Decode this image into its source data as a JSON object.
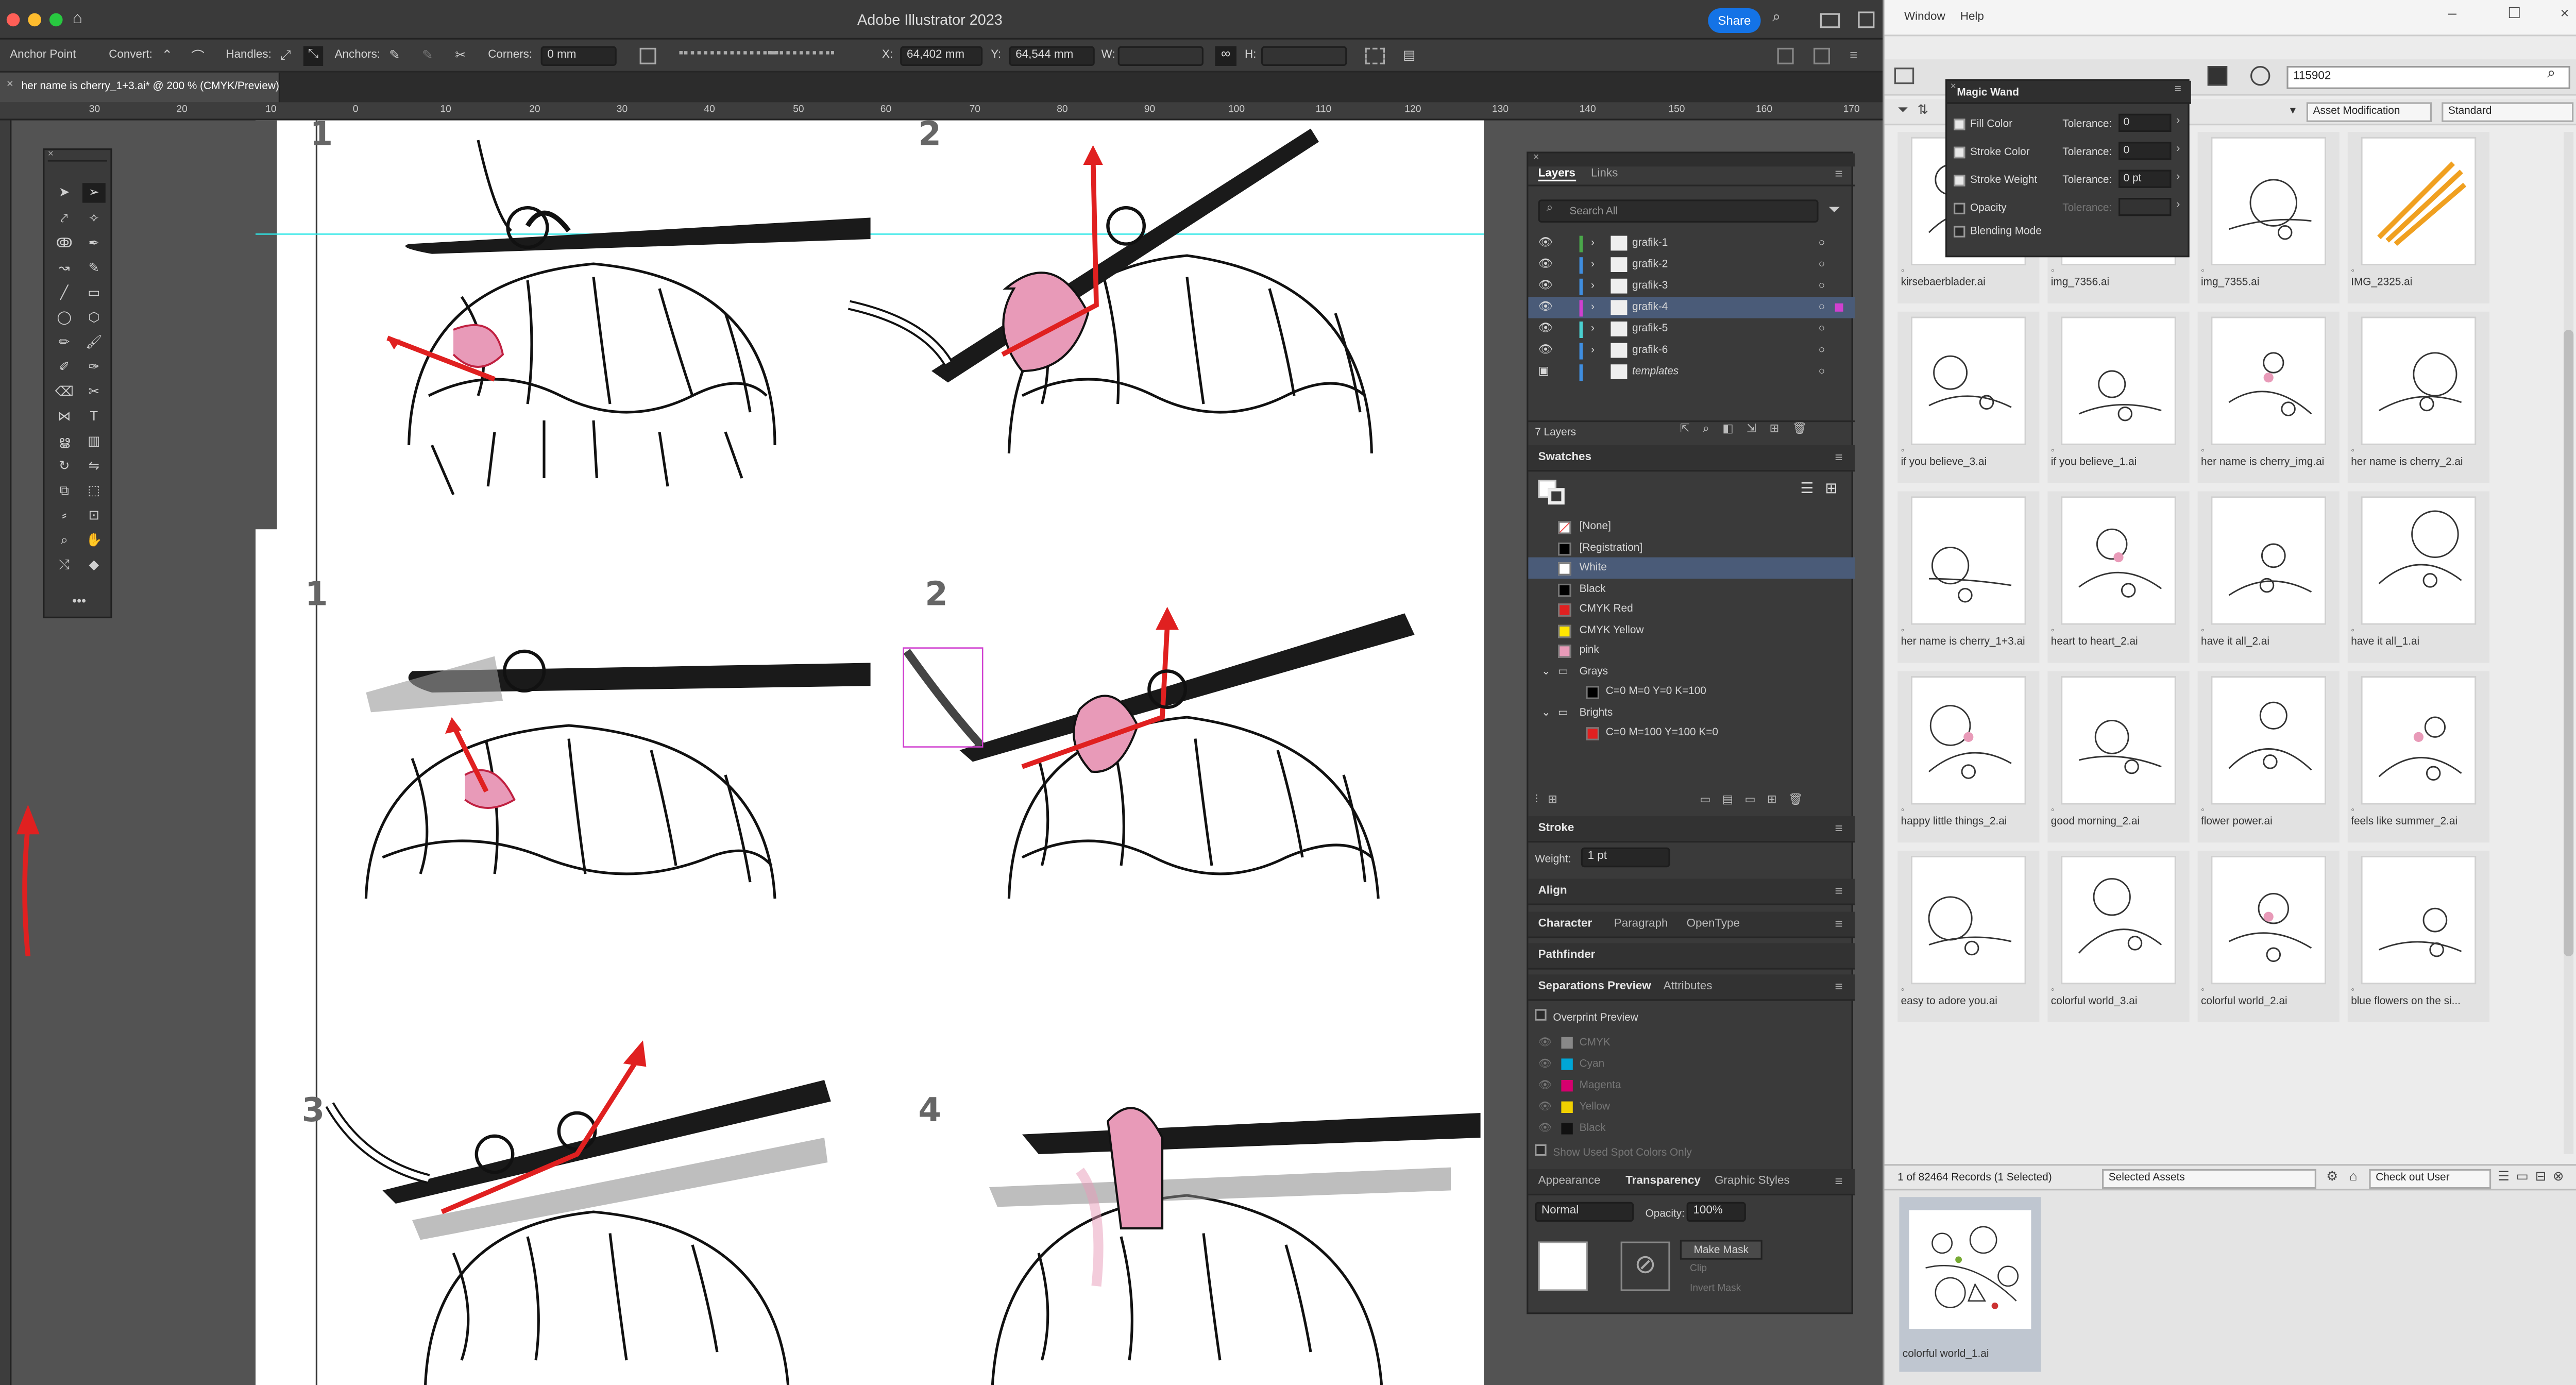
{
  "app": {
    "title": "Adobe Illustrator 2023",
    "share": "Share"
  },
  "control": {
    "tool_name": "Anchor Point",
    "convert": "Convert:",
    "handles": "Handles:",
    "anchors": "Anchors:",
    "corners": "Corners:",
    "corners_value": "0 mm",
    "x_label": "X:",
    "x_value": "64,402 mm",
    "y_label": "Y:",
    "y_value": "64,544 mm",
    "w_label": "W:",
    "h_label": "H:"
  },
  "document": {
    "tab": "her name is cherry_1+3.ai* @ 200 % (CMYK/Preview)"
  },
  "ruler": [
    "30",
    "20",
    "10",
    "0",
    "10",
    "20",
    "30",
    "40",
    "50",
    "60",
    "70",
    "80",
    "90",
    "100",
    "110",
    "120",
    "130",
    "140",
    "150",
    "160",
    "170"
  ],
  "canvas": {
    "step_labels": [
      "1",
      "2",
      "1",
      "2",
      "3",
      "4"
    ]
  },
  "layers": {
    "tabs": [
      "Layers",
      "Links"
    ],
    "search_placeholder": "Search All",
    "items": [
      "grafik-1",
      "grafik-2",
      "grafik-3",
      "grafik-4",
      "grafik-5",
      "grafik-6",
      "templates"
    ],
    "selected_index": 3,
    "count": "7 Layers"
  },
  "swatches": {
    "title": "Swatches",
    "items": [
      "[None]",
      "[Registration]",
      "White",
      "Black",
      "CMYK Red",
      "CMYK Yellow",
      "pink"
    ],
    "colors": [
      "#ffffff",
      "#000000",
      "#ffffff",
      "#000000",
      "#e02020",
      "#ffe600",
      "#e89ab8"
    ],
    "selected_index": 2,
    "groups": [
      {
        "name": "Grays",
        "sub": "C=0 M=0 Y=0 K=100"
      },
      {
        "name": "Brights",
        "sub": "C=0 M=100 Y=100 K=0"
      }
    ]
  },
  "stroke": {
    "title": "Stroke",
    "weight_label": "Weight:",
    "weight_value": "1 pt"
  },
  "align": {
    "title": "Align"
  },
  "character": {
    "tabs": [
      "Character",
      "Paragraph",
      "OpenType"
    ]
  },
  "pathfinder": {
    "title": "Pathfinder"
  },
  "separations": {
    "tabs": [
      "Separations Preview",
      "Attributes"
    ],
    "overprint": "Overprint Preview",
    "plates": [
      "CMYK",
      "Cyan",
      "Magenta",
      "Yellow",
      "Black"
    ],
    "plate_colors": [
      "#888888",
      "#00a6d6",
      "#d6006e",
      "#f0d000",
      "#111111"
    ],
    "spot_only": "Show Used Spot Colors Only"
  },
  "transparency": {
    "tabs": [
      "Appearance",
      "Transparency",
      "Graphic Styles"
    ],
    "mode": "Normal",
    "opacity_label": "Opacity:",
    "opacity_value": "100%",
    "make_mask": "Make Mask",
    "clip": "Clip",
    "invert": "Invert Mask"
  },
  "bridge": {
    "menu": [
      "Window",
      "Help"
    ],
    "search_value": "115902",
    "filter_label": "Asset Modification",
    "view_label": "Standard",
    "thumbs": [
      "kirsebaerblader.ai",
      "img_7356.ai",
      "img_7355.ai",
      "IMG_2325.ai",
      "if you believe_3.ai",
      "if you believe_1.ai",
      "her name is cherry_img.ai",
      "her name is cherry_2.ai",
      "her name is cherry_1+3.ai",
      "heart to heart_2.ai",
      "have it all_2.ai",
      "have it all_1.ai",
      "happy little things_2.ai",
      "good morning_2.ai",
      "flower power.ai",
      "feels like summer_2.ai",
      "easy to adore you.ai",
      "colorful world_3.ai",
      "colorful world_2.ai",
      "blue flowers on the si..."
    ],
    "status": "1 of 82464 Records (1 Selected)",
    "selected_assets": "Selected Assets",
    "checkout": "Check out User",
    "preview_caption": "colorful world_1.ai"
  },
  "magic_wand": {
    "title": "Magic Wand",
    "rows": [
      {
        "label": "Fill Color",
        "tol": "0",
        "checked": true
      },
      {
        "label": "Stroke Color",
        "tol": "0",
        "checked": true
      },
      {
        "label": "Stroke Weight",
        "tol": "0 pt",
        "checked": true
      },
      {
        "label": "Opacity",
        "tol": "",
        "checked": false
      },
      {
        "label": "Blending Mode",
        "tol": "",
        "checked": false
      }
    ],
    "tolerance_label": "Tolerance:"
  }
}
